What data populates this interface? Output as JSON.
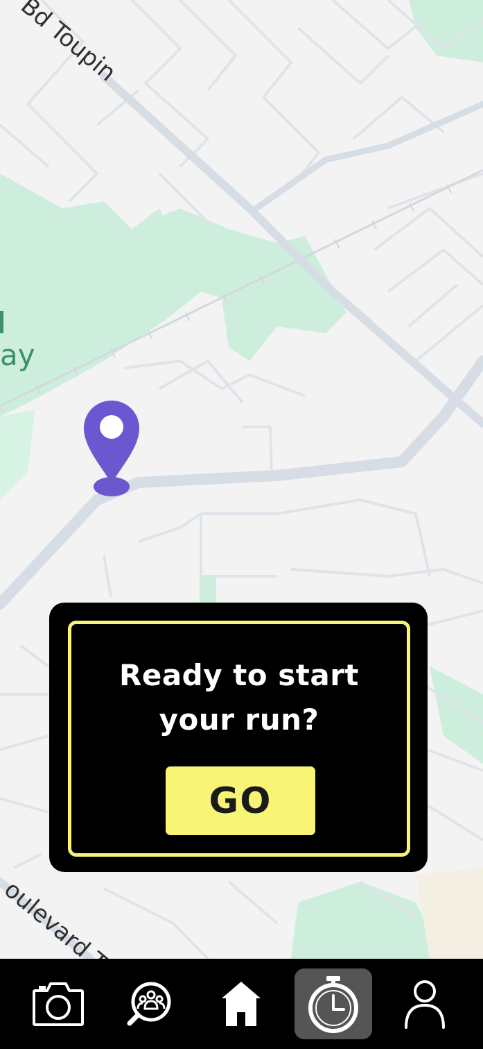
{
  "map": {
    "street_labels": [
      "Bd Toupin",
      "oulevard T"
    ],
    "park_label": "ay"
  },
  "run_prompt": {
    "title_line1": "Ready to start",
    "title_line2": "your run?",
    "go_label": "GO"
  },
  "nav": {
    "items": [
      {
        "name": "camera",
        "icon": "camera-icon",
        "active": false
      },
      {
        "name": "community",
        "icon": "community-search-icon",
        "active": false
      },
      {
        "name": "home",
        "icon": "home-icon",
        "active": false
      },
      {
        "name": "run-timer",
        "icon": "stopwatch-icon",
        "active": true
      },
      {
        "name": "profile",
        "icon": "profile-icon",
        "active": false
      }
    ]
  },
  "colors": {
    "accent": "#f8f476",
    "pin": "#6b57cf",
    "nav_bg": "#000000",
    "nav_active": "#555555",
    "park": "#cdeedd",
    "road": "#d7dde5"
  }
}
